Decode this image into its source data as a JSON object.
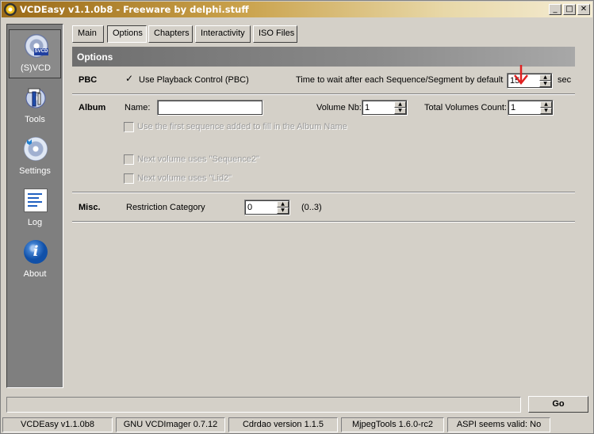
{
  "window": {
    "title": "VCDEasy v1.1.0b8 - Freeware by delphi.stuff",
    "controls": {
      "minimize": "_",
      "maximize": "□",
      "close": "✕"
    }
  },
  "sidebar": {
    "items": [
      {
        "label": "(S)VCD",
        "icon": "svcd-disc-icon",
        "badge": "SVCD",
        "active": true
      },
      {
        "label": "Tools",
        "icon": "tools-icon",
        "active": false
      },
      {
        "label": "Settings",
        "icon": "settings-icon",
        "active": false
      },
      {
        "label": "Log",
        "icon": "log-icon",
        "active": false
      },
      {
        "label": "About",
        "icon": "about-icon",
        "glyph": "i",
        "active": false
      }
    ]
  },
  "tabs": [
    {
      "label": "Main",
      "active": false
    },
    {
      "label": "Options",
      "active": true
    },
    {
      "label": "Chapters",
      "active": false
    },
    {
      "label": "Interactivity",
      "active": false
    },
    {
      "label": "ISO Files",
      "active": false
    }
  ],
  "options": {
    "header": "Options",
    "pbc": {
      "section_label": "PBC",
      "checkbox_label": "Use Playback Control (PBC)",
      "checked": true,
      "wait_label": "Time to wait after each Sequence/Segment by default",
      "wait_value": "15",
      "wait_unit": "sec"
    },
    "album": {
      "section_label": "Album",
      "name_label": "Name:",
      "name_value": "",
      "volume_nb_label": "Volume Nb:",
      "volume_nb_value": "1",
      "total_volumes_label": "Total Volumes Count:",
      "total_volumes_value": "1",
      "use_first_sequence_label": "Use the first sequence added to fill in the Album Name",
      "next_volume_sequence2_label": "Next volume uses \"Sequence2\"",
      "next_volume_lid2_label": "Next volume uses \"Lid2\""
    },
    "misc": {
      "section_label": "Misc.",
      "restriction_label": "Restriction Category",
      "restriction_value": "0",
      "restriction_range": "(0..3)"
    }
  },
  "actions": {
    "go_label": "Go"
  },
  "status": [
    "VCDEasy v1.1.0b8",
    "GNU VCDImager 0.7.12",
    "Cdrdao version 1.1.5",
    "MjpegTools 1.6.0-rc2",
    "ASPI seems valid: No"
  ],
  "colors": {
    "face": "#d4d0c8",
    "sidebar": "#7f7f7f",
    "title_start": "#9a6a18",
    "title_end": "#f4ecd4",
    "annotation_arrow": "#e02020"
  }
}
